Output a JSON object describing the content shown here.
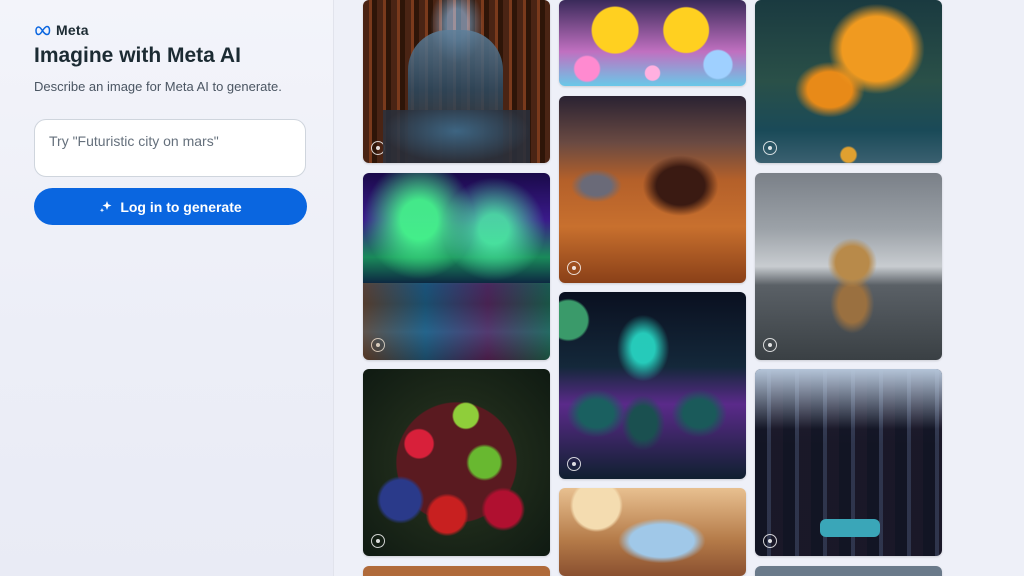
{
  "brand": {
    "logo_text": "Meta",
    "accent": "#0a66e0"
  },
  "sidebar": {
    "title": "Imagine with Meta AI",
    "subtitle": "Describe an image for Meta AI to generate.",
    "prompt_placeholder": "Try \"Futuristic city on mars\"",
    "prompt_value": "",
    "generate_label": "Log in to generate",
    "generate_icon": "sparkle-icon"
  },
  "gallery": {
    "tiles": [
      {
        "subject": "library",
        "badge_icon": "meta-ai-icon"
      },
      {
        "subject": "aurora",
        "badge_icon": "meta-ai-icon"
      },
      {
        "subject": "fruit",
        "badge_icon": "meta-ai-icon"
      },
      {
        "subject": "ducks",
        "badge_icon": "meta-ai-icon"
      },
      {
        "subject": "mars-car",
        "badge_icon": "meta-ai-icon"
      },
      {
        "subject": "astronauts",
        "badge_icon": "meta-ai-icon"
      },
      {
        "subject": "bird",
        "badge_icon": "meta-ai-icon"
      },
      {
        "subject": "butterfly",
        "badge_icon": "meta-ai-icon"
      },
      {
        "subject": "dog",
        "badge_icon": "meta-ai-icon"
      },
      {
        "subject": "city",
        "badge_icon": "meta-ai-icon"
      }
    ]
  }
}
